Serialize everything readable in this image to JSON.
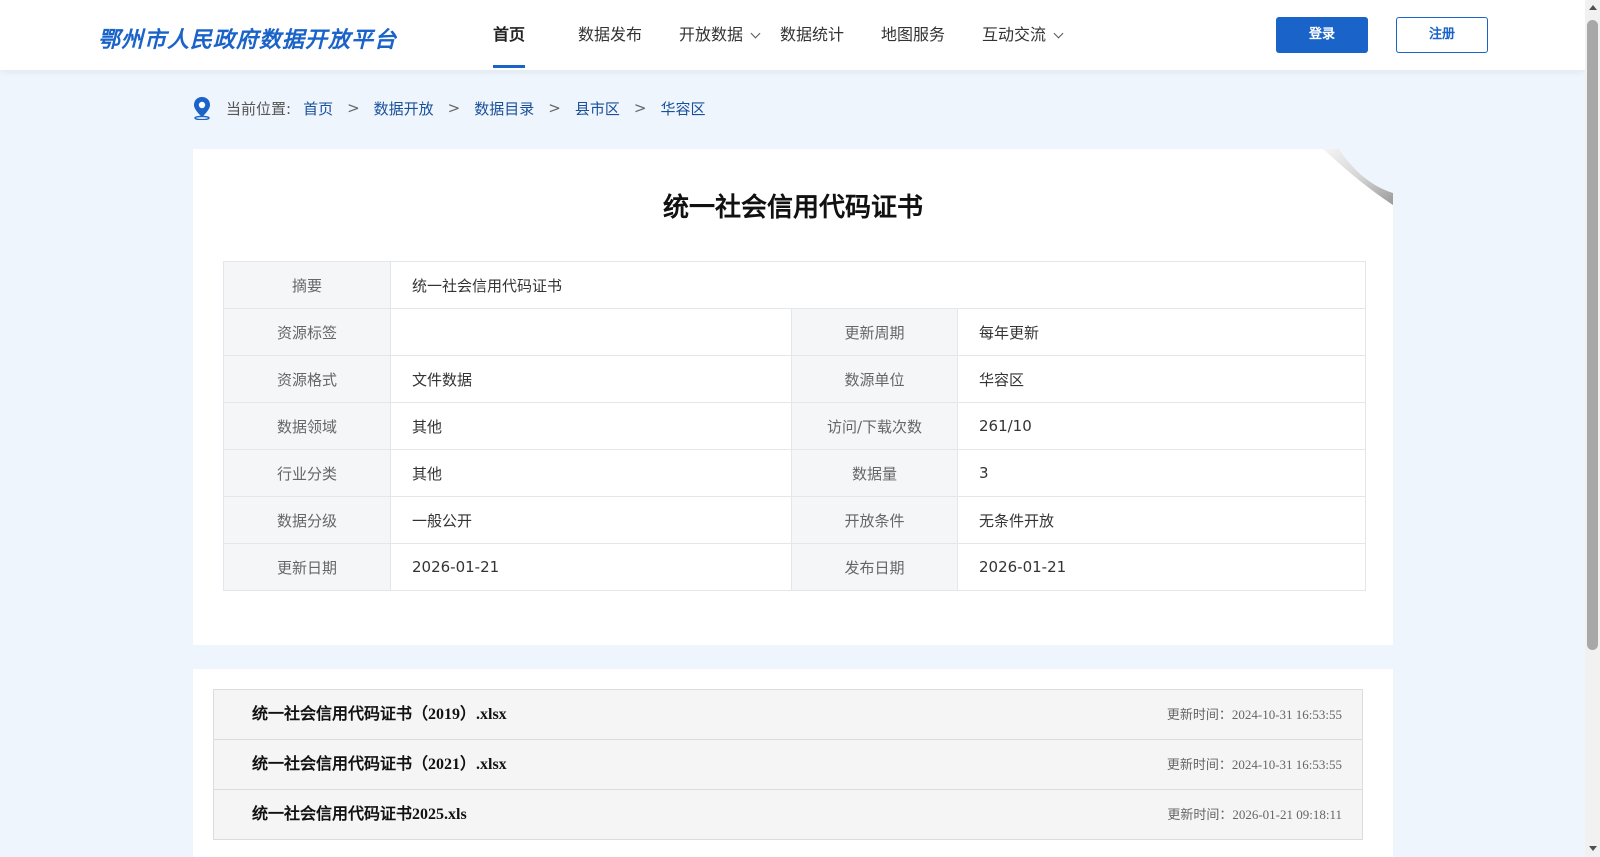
{
  "header": {
    "logo_text": "鄂州市人民政府数据开放平台",
    "nav": [
      {
        "label": "首页"
      },
      {
        "label": "数据发布"
      },
      {
        "label": "开放数据"
      },
      {
        "label": "数据统计"
      },
      {
        "label": "地图服务"
      },
      {
        "label": "互动交流"
      }
    ],
    "login_label": "登录",
    "register_label": "注册"
  },
  "breadcrumb": {
    "prefix": "当前位置:",
    "items": [
      "首页",
      "数据开放",
      "数据目录",
      "县市区",
      "华容区"
    ],
    "separator": ">"
  },
  "doc": {
    "title": "统一社会信用代码证书",
    "summary_label": "摘要",
    "summary_value": "统一社会信用代码证书",
    "rows": [
      {
        "l1": "资源标签",
        "v1": "",
        "l2": "更新周期",
        "v2": "每年更新"
      },
      {
        "l1": "资源格式",
        "v1": "文件数据",
        "l2": "数源单位",
        "v2": "华容区"
      },
      {
        "l1": "数据领域",
        "v1": "其他",
        "l2": "访问/下载次数",
        "v2": "261/10"
      },
      {
        "l1": "行业分类",
        "v1": "其他",
        "l2": "数据量",
        "v2": "3"
      },
      {
        "l1": "数据分级",
        "v1": "一般公开",
        "l2": "开放条件",
        "v2": "无条件开放"
      },
      {
        "l1": "更新日期",
        "v1": "2026-01-21",
        "l2": "发布日期",
        "v2": "2026-01-21"
      }
    ]
  },
  "files": [
    {
      "name": "统一社会信用代码证书（2019）.xlsx",
      "time": "更新时间：2024-10-31 16:53:55"
    },
    {
      "name": "统一社会信用代码证书（2021）.xlsx",
      "time": "更新时间：2024-10-31 16:53:55"
    },
    {
      "name": "统一社会信用代码证书2025.xls",
      "time": "更新时间：2026-01-21 09:18:11"
    }
  ],
  "colors": {
    "brand": "#1a63c8",
    "page_bg": "#eef5fd"
  }
}
